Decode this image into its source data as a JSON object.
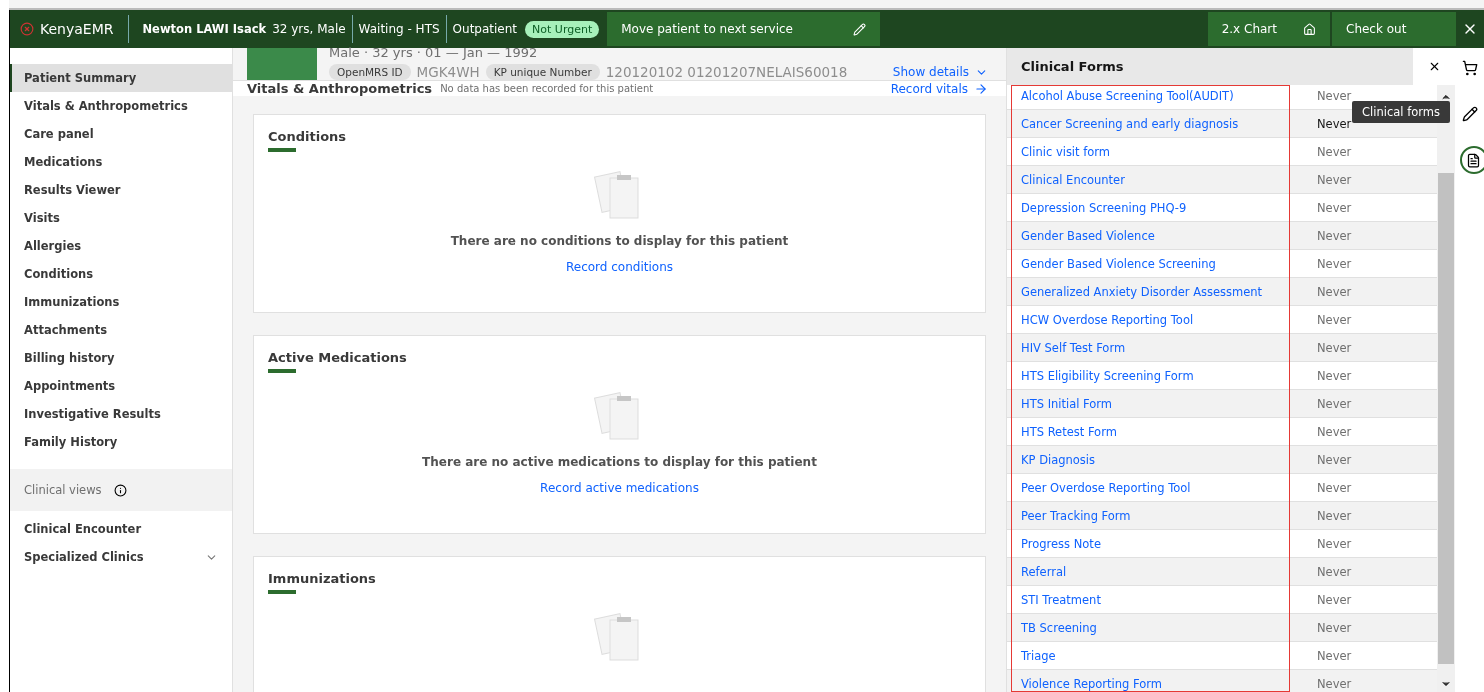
{
  "header": {
    "brand": "KenyaEMR",
    "patient_name": "Newton LAWI Isack",
    "patient_info": "32 yrs, Male",
    "queue_status": "Waiting - HTS",
    "visit_type": "Outpatient",
    "priority": "Not Urgent",
    "move_button": "Move patient to next service",
    "chart_button": "2.x Chart",
    "checkout_button": "Check out"
  },
  "patient": {
    "demographics": "Male · 32 yrs · 01 — Jan — 1992",
    "identifiers": [
      {
        "label": "OpenMRS ID",
        "value": "MGK4WH"
      },
      {
        "label": "KP unique Number",
        "value": "120120102 01201207NELAIS60018"
      }
    ],
    "details_link": "Show details"
  },
  "sidebar": {
    "items": [
      {
        "label": "Patient Summary",
        "selected": true
      },
      {
        "label": "Vitals & Anthropometrics",
        "selected": false
      },
      {
        "label": "Care panel",
        "selected": false
      },
      {
        "label": "Medications",
        "selected": false
      },
      {
        "label": "Results Viewer",
        "selected": false
      },
      {
        "label": "Visits",
        "selected": false
      },
      {
        "label": "Allergies",
        "selected": false
      },
      {
        "label": "Conditions",
        "selected": false
      },
      {
        "label": "Immunizations",
        "selected": false
      },
      {
        "label": "Attachments",
        "selected": false
      },
      {
        "label": "Billing history",
        "selected": false
      },
      {
        "label": "Appointments",
        "selected": false
      },
      {
        "label": "Investigative Results",
        "selected": false
      },
      {
        "label": "Family History",
        "selected": false
      }
    ],
    "section_title": "Clinical views",
    "views": [
      {
        "label": "Clinical Encounter",
        "expandable": false
      },
      {
        "label": "Specialized Clinics",
        "expandable": true
      }
    ]
  },
  "vitals": {
    "title": "Vitals & Anthropometrics",
    "note": "No data has been recorded for this patient",
    "link": "Record vitals"
  },
  "cards": [
    {
      "title": "Conditions",
      "empty_message": "There are no conditions to display for this patient",
      "action": "Record conditions"
    },
    {
      "title": "Active Medications",
      "empty_message": "There are no active medications to display for this patient",
      "action": "Record active medications"
    },
    {
      "title": "Immunizations"
    }
  ],
  "clinical_forms": {
    "title": "Clinical Forms",
    "forms": [
      {
        "name": "Alcohol Abuse Screening Tool(AUDIT)",
        "last_completed": "Never"
      },
      {
        "name": "Cancer Screening and early diagnosis",
        "last_completed": "Never"
      },
      {
        "name": "Clinic visit form",
        "last_completed": "Never"
      },
      {
        "name": "Clinical Encounter",
        "last_completed": "Never"
      },
      {
        "name": "Depression Screening PHQ-9",
        "last_completed": "Never"
      },
      {
        "name": "Gender Based Violence",
        "last_completed": "Never"
      },
      {
        "name": "Gender Based Violence Screening",
        "last_completed": "Never"
      },
      {
        "name": "Generalized Anxiety Disorder Assessment",
        "last_completed": "Never"
      },
      {
        "name": "HCW Overdose Reporting Tool",
        "last_completed": "Never"
      },
      {
        "name": "HIV Self Test Form",
        "last_completed": "Never"
      },
      {
        "name": "HTS Eligibility Screening Form",
        "last_completed": "Never"
      },
      {
        "name": "HTS Initial Form",
        "last_completed": "Never"
      },
      {
        "name": "HTS Retest Form",
        "last_completed": "Never"
      },
      {
        "name": "KP Diagnosis",
        "last_completed": "Never"
      },
      {
        "name": "Peer Overdose Reporting Tool",
        "last_completed": "Never"
      },
      {
        "name": "Peer Tracking Form",
        "last_completed": "Never"
      },
      {
        "name": "Progress Note",
        "last_completed": "Never"
      },
      {
        "name": "Referral",
        "last_completed": "Never"
      },
      {
        "name": "STI Treatment",
        "last_completed": "Never"
      },
      {
        "name": "TB Screening",
        "last_completed": "Never"
      },
      {
        "name": "Triage",
        "last_completed": "Never"
      },
      {
        "name": "Violence Reporting Form",
        "last_completed": "Never"
      }
    ]
  },
  "tooltip": "Clinical forms"
}
